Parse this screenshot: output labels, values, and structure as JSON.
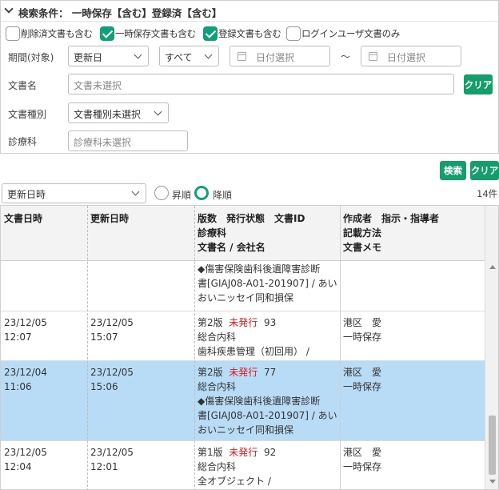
{
  "search": {
    "header_title": "検索条件： 一時保存【含む】登録済【含む】",
    "checkboxes": [
      {
        "label": "削除済文書も含む",
        "checked": false
      },
      {
        "label": "一時保存文書も含む",
        "checked": true
      },
      {
        "label": "登録文書も含む",
        "checked": true
      },
      {
        "label": "ログインユーザ文書のみ",
        "checked": false
      }
    ],
    "period_label": "期間(対象)",
    "period_target": "更新日",
    "period_range": "すべて",
    "date_from_placeholder": "日付選択",
    "date_sep": "～",
    "date_to_placeholder": "日付選択",
    "doc_name_label": "文書名",
    "doc_name_placeholder": "文書未選択",
    "clear_label": "クリア",
    "doc_type_label": "文書種別",
    "doc_type_value": "文書種別未選択",
    "dept_label": "診療科",
    "dept_placeholder": "診療科未選択",
    "search_button": "検索",
    "clear_all_button": "クリア"
  },
  "sort": {
    "field": "更新日時",
    "asc_label": "昇順",
    "desc_label": "降順",
    "selected": "desc",
    "count": "14件"
  },
  "table": {
    "headers": {
      "doc_date": "文書日時",
      "updated": "更新日時",
      "col3": [
        "版数　発行状態　文書ID",
        "診療科",
        "文書名 / 会社名"
      ],
      "col4": [
        "作成者　指示・指導者",
        "記載方法",
        "文書メモ"
      ]
    },
    "rows": [
      {
        "selected": false,
        "doc_date": [
          "",
          ""
        ],
        "updated": [
          "",
          ""
        ],
        "col3_line1": {
          "ver": "",
          "status": "",
          "id": ""
        },
        "col3_lines": [
          "◆傷害保険歯科後遺障害診断",
          "書[GIAJ08-A01-201907] / あい",
          "おいニッセイ同和損保"
        ],
        "col4_lines": [
          "",
          ""
        ]
      },
      {
        "selected": false,
        "doc_date": [
          "23/12/05",
          "12:07"
        ],
        "updated": [
          "23/12/05",
          "15:07"
        ],
        "col3_line1": {
          "ver": "第2版",
          "status": "未発行",
          "id": "93"
        },
        "col3_lines": [
          "総合内科",
          "歯科疾患管理（初回用） /"
        ],
        "col4_lines": [
          "港区　愛",
          "一時保存"
        ]
      },
      {
        "selected": true,
        "doc_date": [
          "23/12/04",
          "11:06"
        ],
        "updated": [
          "23/12/05",
          "15:06"
        ],
        "col3_line1": {
          "ver": "第2版",
          "status": "未発行",
          "id": "77"
        },
        "col3_lines": [
          "総合内科",
          "◆傷害保険歯科後遺障害診断",
          "書[GIAJ08-A01-201907] / あい",
          "おいニッセイ同和損保"
        ],
        "col4_lines": [
          "港区　愛",
          "一時保存"
        ]
      },
      {
        "selected": false,
        "doc_date": [
          "23/12/05",
          "12:04"
        ],
        "updated": [
          "23/12/05",
          "12:01"
        ],
        "col3_line1": {
          "ver": "第1版",
          "status": "未発行",
          "id": "92"
        },
        "col3_lines": [
          "総合内科",
          "全オブジェクト /"
        ],
        "col4_lines": [
          "港区　愛",
          "一時保存"
        ]
      }
    ]
  },
  "colors": {
    "accent": "#149e6c",
    "selected_row": "#b8dcf6",
    "status_red": "#e11919"
  }
}
